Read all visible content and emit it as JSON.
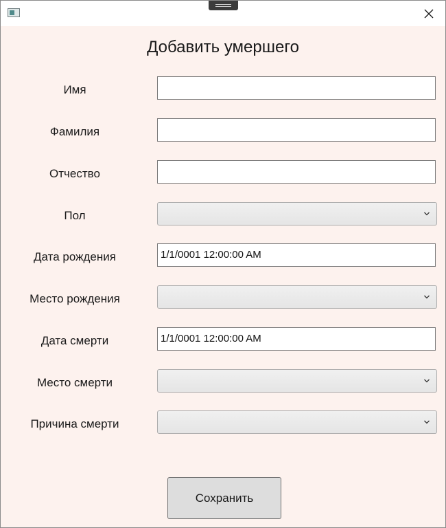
{
  "window": {
    "title": "Добавить умершего",
    "close_icon": "close-icon",
    "app_icon": "window-app-icon"
  },
  "fields": {
    "first_name": {
      "label": "Имя",
      "value": ""
    },
    "last_name": {
      "label": "Фамилия",
      "value": ""
    },
    "patronymic": {
      "label": "Отчество",
      "value": ""
    },
    "gender": {
      "label": "Пол",
      "selected": ""
    },
    "birth_date": {
      "label": "Дата рождения",
      "value": "1/1/0001 12:00:00 AM"
    },
    "birth_place": {
      "label": "Место рождения",
      "selected": ""
    },
    "death_date": {
      "label": "Дата смерти",
      "value": "1/1/0001 12:00:00 AM"
    },
    "death_place": {
      "label": "Место смерти",
      "selected": ""
    },
    "death_cause": {
      "label": "Причина смерти",
      "selected": ""
    }
  },
  "actions": {
    "save_label": "Сохранить"
  },
  "colors": {
    "background": "#fdf2ee",
    "titlebar": "#ffffff",
    "button": "#dddddd"
  }
}
